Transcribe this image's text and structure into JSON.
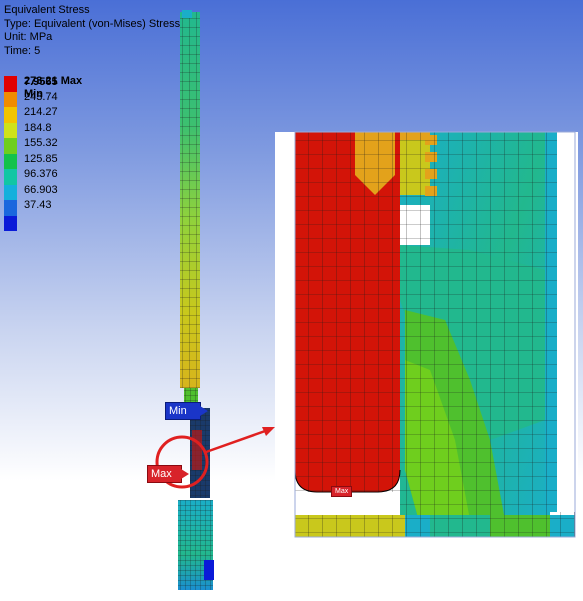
{
  "header": {
    "title": "Equivalent Stress",
    "type": "Type: Equivalent (von-Mises) Stress",
    "unit": "Unit: MPa",
    "time": "Time: 5"
  },
  "legend": {
    "entries": [
      {
        "label": "273.21 Max",
        "color": "#e10000",
        "bold": true
      },
      {
        "label": "243.74",
        "color": "#f08c00"
      },
      {
        "label": "214.27",
        "color": "#f2c400"
      },
      {
        "label": "184.8",
        "color": "#cfe21a"
      },
      {
        "label": "155.32",
        "color": "#6fce1e"
      },
      {
        "label": "125.85",
        "color": "#13c24c"
      },
      {
        "label": "96.376",
        "color": "#11c6a4"
      },
      {
        "label": "66.903",
        "color": "#14b0dc"
      },
      {
        "label": "37.43",
        "color": "#1a67de"
      },
      {
        "label": "",
        "color": "#0a1ad8"
      }
    ],
    "min_label": "7.9565 Min"
  },
  "probes": {
    "min_label": "Min",
    "max_label": "Max",
    "max_zoom_label": "Max"
  },
  "colors": {
    "red": "#d31408",
    "orange": "#e3a21b",
    "yellow": "#c9c81c",
    "green": "#4fc02e",
    "cyan": "#1aaec8",
    "teal": "#22b88e",
    "blue": "#1a50d8",
    "mesh": "#1a1a1a",
    "callout": "#e02020"
  }
}
